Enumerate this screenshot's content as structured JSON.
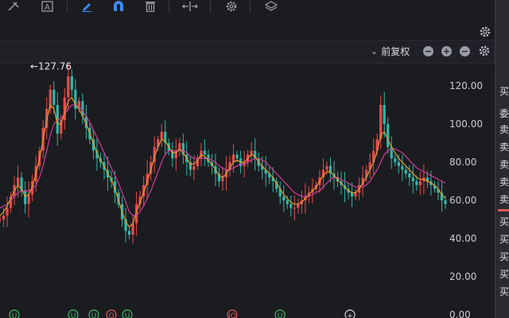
{
  "toolbar": {
    "icons": [
      "crosshair-tool-icon",
      "text-tool-icon",
      "pen-icon",
      "magnet-icon",
      "trash-icon",
      "range-icon",
      "settings-icon",
      "layers-icon"
    ]
  },
  "price_adjust": {
    "label": "前复权",
    "arrow": "⌄"
  },
  "controls": {
    "minus": "−",
    "plus": "+"
  },
  "max_label": "←127.76",
  "y_axis": {
    "ticks": [
      "120.00",
      "100.00",
      "80.00",
      "60.00",
      "40.00",
      "20.00",
      "0.00"
    ]
  },
  "sidebar": {
    "items": [
      "买",
      "委",
      "卖",
      "卖",
      "卖",
      "卖",
      "卖",
      "买",
      "买",
      "买",
      "买",
      "买"
    ]
  },
  "bottom_markers": [
    "U",
    "U",
    "U",
    "Q",
    "U",
    "IQ",
    "U",
    "+"
  ],
  "colors": {
    "background": "#1b1c20",
    "ma_orange": "#e09a2e",
    "ma_magenta": "#d43b9b",
    "up": "#e84b4b",
    "down": "#2fb8a8",
    "accent": "#3d8bf2"
  },
  "chart_data": {
    "type": "candlestick",
    "ylim": [
      0,
      130
    ],
    "max_value": 127.76,
    "y_ticks": [
      120,
      100,
      80,
      60,
      40,
      20,
      0
    ],
    "close_series": [
      50,
      52,
      56,
      62,
      68,
      72,
      65,
      58,
      63,
      70,
      78,
      86,
      98,
      108,
      118,
      110,
      95,
      102,
      114,
      125,
      118,
      108,
      112,
      104,
      98,
      92,
      86,
      82,
      80,
      76,
      72,
      70,
      64,
      58,
      50,
      44,
      42,
      48,
      58,
      62,
      68,
      74,
      80,
      88,
      92,
      96,
      90,
      86,
      82,
      86,
      90,
      84,
      80,
      76,
      78,
      82,
      86,
      84,
      80,
      78,
      74,
      70,
      72,
      76,
      80,
      84,
      82,
      78,
      80,
      84,
      86,
      82,
      78,
      76,
      74,
      72,
      70,
      66,
      62,
      60,
      58,
      56,
      56,
      58,
      60,
      62,
      64,
      66,
      68,
      72,
      76,
      78,
      74,
      72,
      70,
      68,
      66,
      64,
      62,
      64,
      68,
      72,
      76,
      80,
      86,
      92,
      110,
      100,
      88,
      82,
      80,
      78,
      76,
      74,
      72,
      70,
      68,
      70,
      72,
      70,
      68,
      66,
      64,
      60,
      58
    ],
    "ma_short": [
      52,
      54,
      57,
      61,
      65,
      68,
      66,
      62,
      63,
      67,
      74,
      82,
      92,
      102,
      110,
      108,
      100,
      100,
      106,
      112,
      114,
      110,
      108,
      104,
      100,
      95,
      90,
      85,
      81,
      78,
      74,
      71,
      66,
      60,
      54,
      49,
      46,
      48,
      54,
      59,
      64,
      70,
      76,
      83,
      88,
      92,
      91,
      88,
      85,
      85,
      87,
      85,
      82,
      79,
      79,
      81,
      84,
      83,
      81,
      79,
      76,
      73,
      72,
      74,
      77,
      80,
      81,
      80,
      80,
      82,
      84,
      83,
      80,
      78,
      76,
      74,
      72,
      69,
      66,
      63,
      61,
      59,
      58,
      58,
      59,
      61,
      63,
      65,
      67,
      70,
      73,
      75,
      75,
      73,
      71,
      69,
      67,
      65,
      64,
      64,
      66,
      69,
      72,
      76,
      80,
      86,
      94,
      96,
      92,
      88,
      85,
      82,
      80,
      78,
      76,
      74,
      72,
      71,
      71,
      70,
      69,
      68,
      66,
      63,
      61
    ],
    "ma_long": [
      56,
      57,
      58,
      60,
      62,
      64,
      65,
      65,
      65,
      66,
      68,
      72,
      78,
      86,
      94,
      100,
      102,
      103,
      105,
      108,
      110,
      110,
      109,
      107,
      104,
      101,
      97,
      93,
      89,
      85,
      81,
      77,
      73,
      69,
      64,
      59,
      54,
      52,
      52,
      54,
      57,
      61,
      65,
      70,
      75,
      80,
      84,
      86,
      86,
      86,
      86,
      86,
      85,
      83,
      82,
      82,
      82,
      82,
      82,
      81,
      80,
      78,
      77,
      76,
      76,
      77,
      78,
      79,
      79,
      80,
      81,
      82,
      82,
      81,
      80,
      78,
      76,
      74,
      72,
      70,
      68,
      66,
      64,
      63,
      62,
      62,
      62,
      63,
      64,
      65,
      67,
      69,
      71,
      72,
      72,
      71,
      70,
      69,
      68,
      67,
      67,
      67,
      68,
      70,
      73,
      76,
      80,
      84,
      86,
      87,
      87,
      86,
      85,
      83,
      81,
      79,
      77,
      76,
      75,
      74,
      73,
      72,
      71,
      70,
      69
    ]
  }
}
